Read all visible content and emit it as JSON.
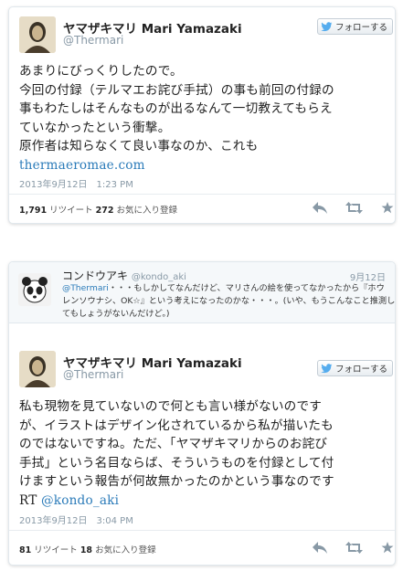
{
  "tweet1": {
    "name": "ヤマザキマリ  Mari Yamazaki",
    "handle": "@Thermari",
    "follow_label": "フォローする",
    "lines": [
      "あまりにびっくりしたので。",
      "今回の付録（テルマエお詫び手拭）の事も前回の付録の",
      "事もわたしはそんなものが出るなんて一切教えてもらえ",
      "ていなかったという衝撃。",
      "原作者は知らなくて良い事なのか、これも"
    ],
    "link": "thermaeromae.com",
    "date": "2013年9月12日　1:23 PM",
    "retweets": "1,791",
    "retweets_label": "リツイート",
    "favorites": "272",
    "favorites_label": "お気に入り登録"
  },
  "tweet2": {
    "reply": {
      "name": "コンドウアキ",
      "handle": "@kondo_aki",
      "date": "9月12日",
      "mention": "@Thermari",
      "line1_rest": "・・・もしかしてなんだけど、マリさんの絵を使ってなかったから『ホウ",
      "line2": "レンソウナシ、OK☆』という考えになったのかな・・・。(いや、もうこんなこと推測し",
      "line3": "てもしょうがないんだけど。)"
    },
    "name": "ヤマザキマリ  Mari Yamazaki",
    "handle": "@Thermari",
    "follow_label": "フォローする",
    "lines": [
      "私も現物を見ていないので何とも言い様がないのです",
      "が、イラストはデザイン化されているから私が描いたも",
      "のではないですね。ただ、「ヤマザキマリからのお詫び",
      "手拭」という名目ならば、そういうものを付録として付",
      "けますという報告が何故無かったのかという事なのです"
    ],
    "last_prefix": "RT ",
    "last_mention": "@kondo_aki",
    "date": "2013年9月12日　3:04 PM",
    "retweets": "81",
    "retweets_label": "リツイート",
    "favorites": "18",
    "favorites_label": "お気に入り登録"
  },
  "icons": {
    "follow": "twitter-bird-icon",
    "reply": "reply-icon",
    "retweet": "retweet-icon",
    "favorite": "star-icon"
  },
  "colors": {
    "link": "#2b7bb9",
    "bird": "#55acee",
    "muted": "#8899a6",
    "action": "#8899a6"
  }
}
